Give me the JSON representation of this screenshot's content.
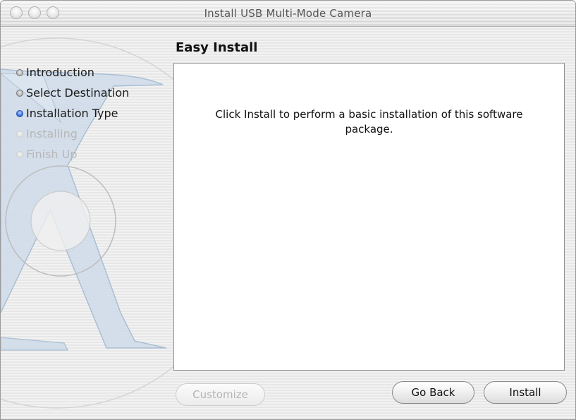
{
  "window": {
    "title": "Install USB Multi-Mode Camera"
  },
  "sidebar": {
    "steps": [
      {
        "label": "Introduction",
        "state": "done"
      },
      {
        "label": "Select Destination",
        "state": "done"
      },
      {
        "label": "Installation Type",
        "state": "current"
      },
      {
        "label": "Installing",
        "state": "pending"
      },
      {
        "label": "Finish Up",
        "state": "pending"
      }
    ]
  },
  "main": {
    "section_title": "Easy Install",
    "message": "Click Install to perform a basic installation of this software package."
  },
  "buttons": {
    "customize": "Customize",
    "go_back": "Go Back",
    "install": "Install"
  },
  "colors": {
    "current_step_bullet": "#3a72d8",
    "pending_step_text": "#b8b8b8",
    "background_art": "#a9c4e0"
  }
}
